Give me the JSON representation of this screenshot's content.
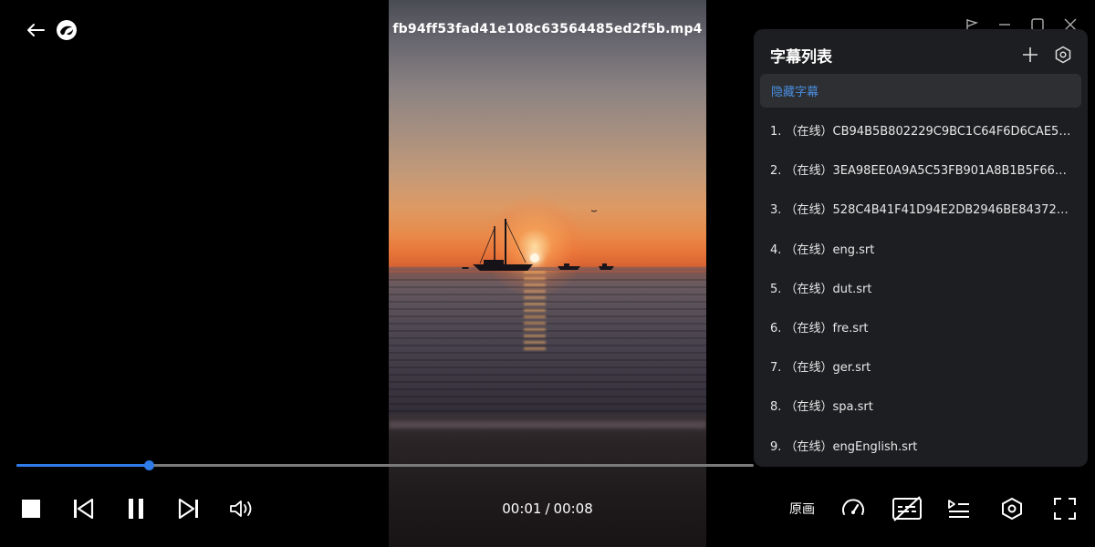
{
  "header": {
    "filename": "fb94ff53fad41e108c63564485ed2f5b.mp4"
  },
  "panel": {
    "title": "字幕列表",
    "hide_label": "隐藏字幕",
    "items": [
      {
        "label": "1. （在线）CB94B5B802229C9BC1C64F6D6CAE5B..."
      },
      {
        "label": "2. （在线）3EA98EE0A9A5C53FB901A8B1B5F66B..."
      },
      {
        "label": "3. （在线）528C4B41F41D94E2DB2946BE84372E..."
      },
      {
        "label": "4. （在线）eng.srt"
      },
      {
        "label": "5. （在线）dut.srt"
      },
      {
        "label": "6. （在线）fre.srt"
      },
      {
        "label": "7. （在线）ger.srt"
      },
      {
        "label": "8. （在线）spa.srt"
      },
      {
        "label": "9. （在线）engEnglish.srt"
      }
    ]
  },
  "playback": {
    "current_time": "00:01",
    "separator": "/",
    "total_time": "00:08",
    "progress_fraction": 0.18
  },
  "controls": {
    "original_label": "原画"
  },
  "colors": {
    "accent": "#2f7be8",
    "panel_bg": "#1e1f22",
    "hide_text": "#4a8fe0"
  },
  "icons": [
    "back-arrow-icon",
    "app-logo-icon",
    "pin-icon",
    "minimize-icon",
    "maximize-icon",
    "close-icon",
    "add-icon",
    "settings-hex-icon",
    "stop-icon",
    "previous-icon",
    "pause-icon",
    "next-icon",
    "volume-icon",
    "speed-gauge-icon",
    "subtitle-off-icon",
    "playlist-icon",
    "fullscreen-icon"
  ]
}
